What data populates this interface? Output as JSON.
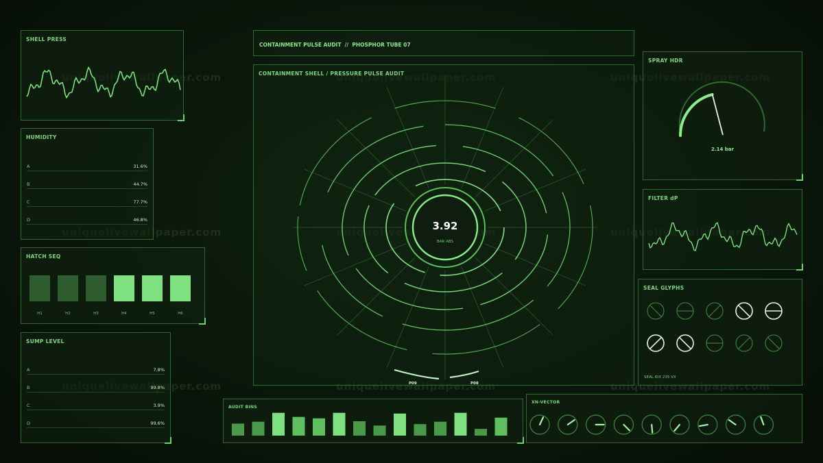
{
  "panels": {
    "shell_press": {
      "title": "SHELL PRESS"
    },
    "humidity": {
      "title": "HUMIDITY",
      "rows": [
        {
          "label": "A",
          "value": "31.6%"
        },
        {
          "label": "B",
          "value": "44.7%"
        },
        {
          "label": "C",
          "value": "77.7%"
        },
        {
          "label": "D",
          "value": "46.8%"
        }
      ]
    },
    "hatch_seq": {
      "title": "HATCH SEQ",
      "blocks": [
        {
          "label": "H1",
          "state": "dim"
        },
        {
          "label": "H2",
          "state": "dim"
        },
        {
          "label": "H3",
          "state": "dim"
        },
        {
          "label": "H4",
          "state": "lit"
        },
        {
          "label": "H5",
          "state": "lit"
        },
        {
          "label": "H6",
          "state": "lit"
        }
      ]
    },
    "sump_level": {
      "title": "SUMP LEVEL",
      "rows": [
        {
          "label": "A",
          "value": "7.8%"
        },
        {
          "label": "B",
          "value": "99.8%"
        },
        {
          "label": "C",
          "value": "3.9%"
        },
        {
          "label": "D",
          "value": "99.6%"
        }
      ]
    },
    "header": {
      "title": "CONTAINMENT PULSE AUDIT  //  PHOSPHOR TUBE 07"
    },
    "main": {
      "title": "CONTAINMENT SHELL / PRESSURE PULSE AUDIT",
      "value": "3.92",
      "unit": "BAR ABS",
      "markers": [
        "P09",
        "P08"
      ]
    },
    "spray_hdr": {
      "title": "SPRAY HDR",
      "value": "2.14 bar",
      "gauge_fraction": 0.42
    },
    "filter_dp": {
      "title": "FILTER dP"
    },
    "seal_glyphs": {
      "title": "SEAL GLYPHS",
      "footer": "SEAL IDX 235 VX",
      "glyphs": [
        {
          "angle": 45,
          "bright": false
        },
        {
          "angle": 0,
          "bright": false
        },
        {
          "angle": -45,
          "bright": false
        },
        {
          "angle": 45,
          "bright": true
        },
        {
          "angle": 0,
          "bright": true
        },
        {
          "angle": -45,
          "bright": true
        },
        {
          "angle": 45,
          "bright": true
        },
        {
          "angle": 0,
          "bright": false
        },
        {
          "angle": -45,
          "bright": false
        },
        {
          "angle": 45,
          "bright": false
        }
      ]
    },
    "audit_bins": {
      "title": "AUDIT BINS",
      "values": [
        0.5,
        0.58,
        0.95,
        0.78,
        0.72,
        0.95,
        0.6,
        0.42,
        0.92,
        0.48,
        0.58,
        0.95,
        0.28,
        0.75
      ]
    },
    "xn_vector": {
      "title": "XN-VECTOR",
      "angles": [
        -65,
        -35,
        0,
        45,
        85,
        130,
        170,
        215,
        250
      ]
    }
  },
  "watermark": "uniquelivewallpaper.com",
  "colors": {
    "accent": "#7fe07f",
    "bright": "#a6f5a6",
    "dim": "#2e5c2e",
    "border": "#2d6b2f",
    "white_glyph": "#e8f5e8"
  }
}
